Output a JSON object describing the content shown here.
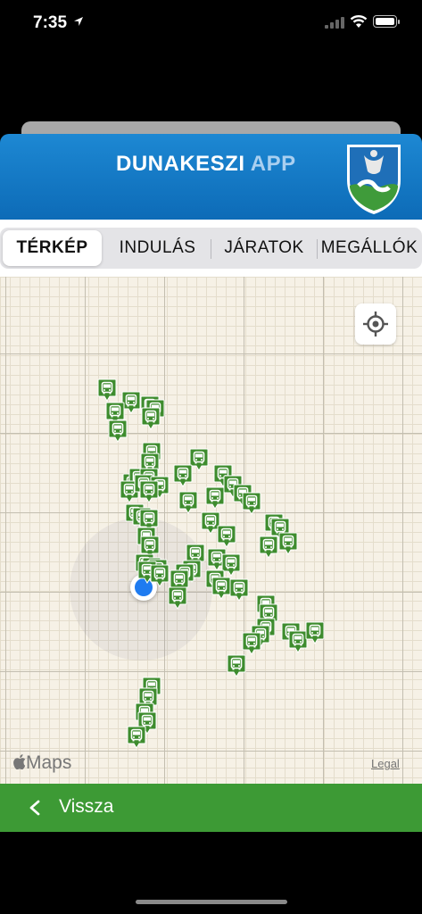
{
  "status": {
    "time": "7:35"
  },
  "header": {
    "title_main": "DUNAKESZI",
    "title_accent": "APP"
  },
  "tabs": [
    {
      "label": "TÉRKÉP",
      "active": true
    },
    {
      "label": "INDULÁS",
      "active": false
    },
    {
      "label": "JÁRATOK",
      "active": false
    },
    {
      "label": "MEGÁLLÓK",
      "active": false
    }
  ],
  "map": {
    "attribution": "Maps",
    "legal": "Legal",
    "marker_icon": "bus-stop-icon",
    "marker_color": "#3e8c2e"
  },
  "footer": {
    "back_label": "Vissza"
  },
  "colors": {
    "header_blue": "#1576c6",
    "footer_green": "#3d9a35",
    "user_dot": "#1e7bf0"
  }
}
